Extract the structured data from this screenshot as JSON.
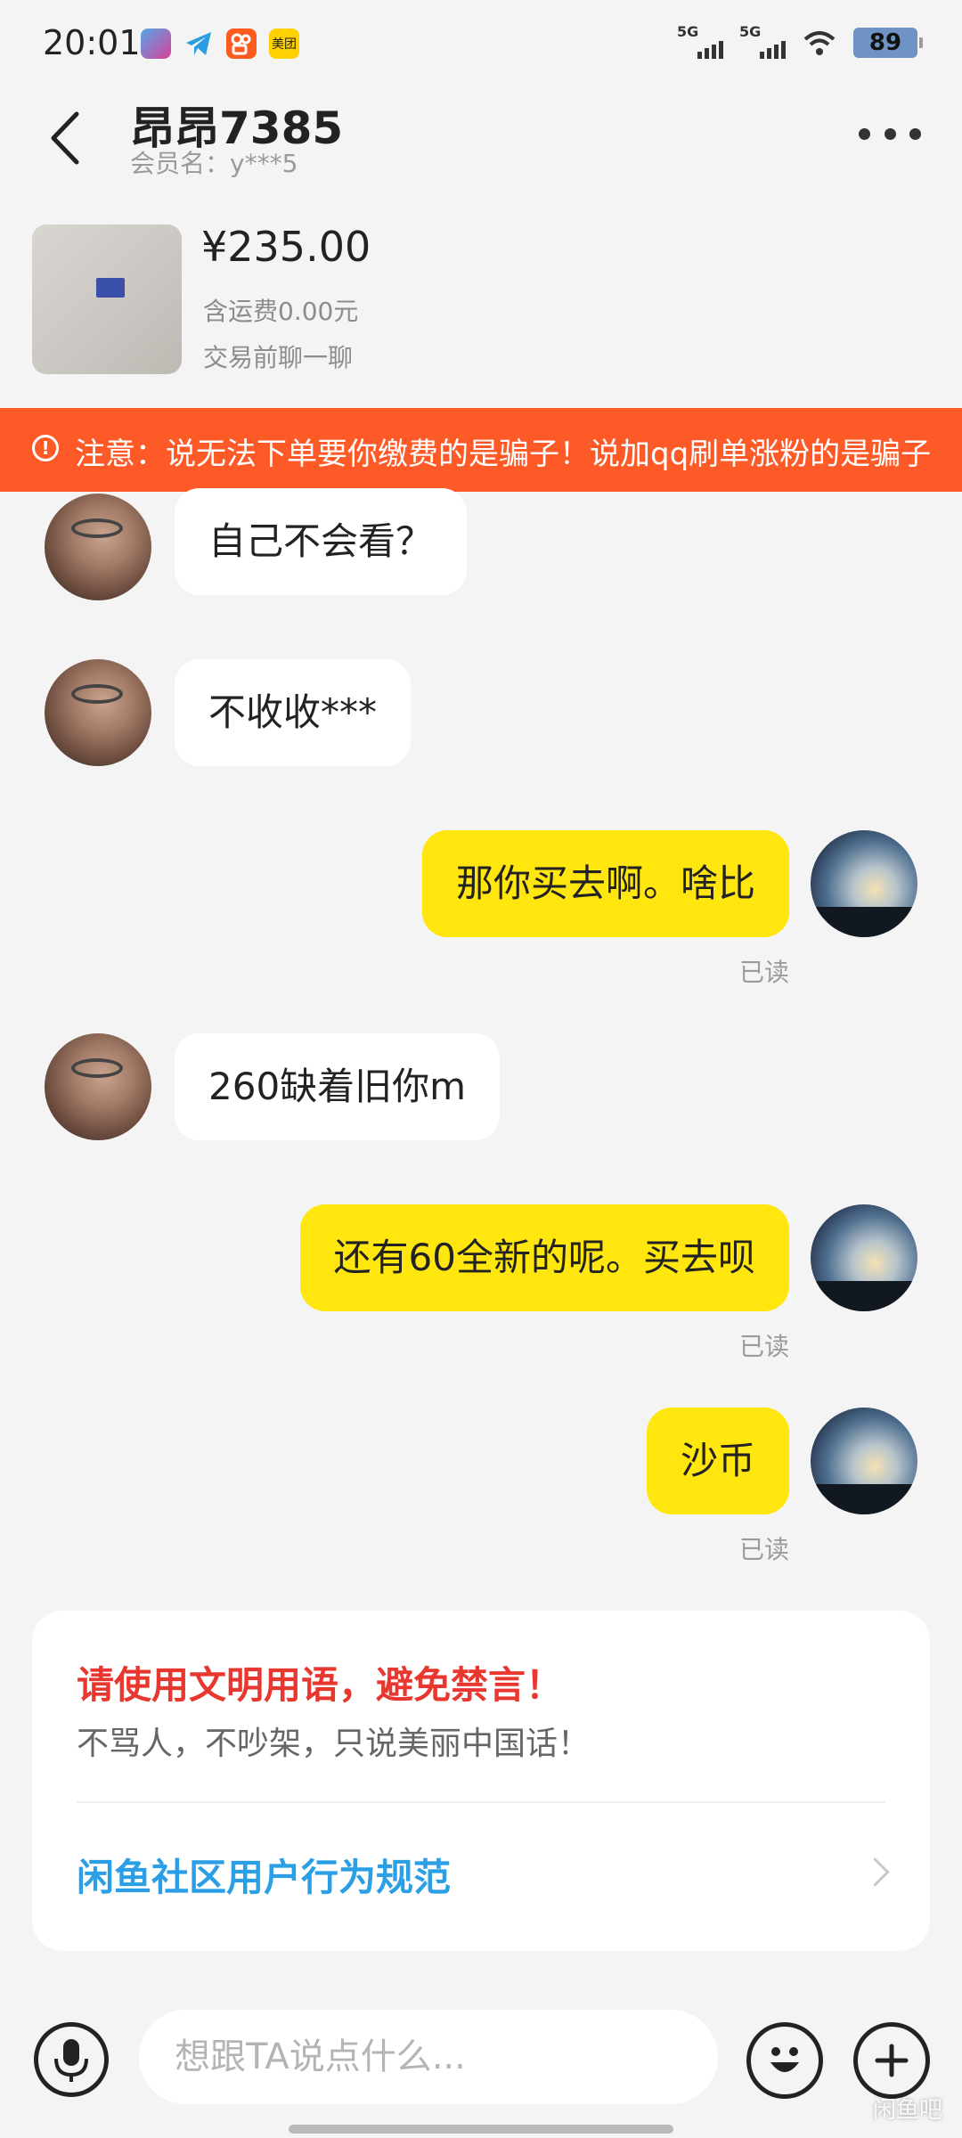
{
  "status_bar": {
    "time": "20:01",
    "app_icons": [
      "photo-app-icon",
      "telegram-app-icon",
      "kuaishou-app-icon",
      "meituan-app-icon"
    ],
    "meituan_label": "美团",
    "signal_1": "5G",
    "signal_2": "5G",
    "battery": "89"
  },
  "header": {
    "seller_name": "昂昂7385",
    "member_name": "会员名：y***5"
  },
  "product": {
    "price": "¥235.00",
    "shipping": "含运费0.00元",
    "chat_before": "交易前聊一聊"
  },
  "warning": {
    "text": "注意：说无法下单要你缴费的是骗子！说加qq刷单涨粉的是骗子"
  },
  "messages": [
    {
      "side": "left",
      "text": "自己不会看？"
    },
    {
      "side": "left",
      "text": "不收收***"
    },
    {
      "side": "right",
      "text": "那你买去啊。啥比",
      "read": "已读"
    },
    {
      "side": "left",
      "text": "260缺着旧你m"
    },
    {
      "side": "right",
      "text": "还有60全新的呢。买去呗",
      "read": "已读"
    },
    {
      "side": "right",
      "text": "沙币",
      "read": "已读"
    }
  ],
  "notice": {
    "title": "请使用文明用语，避免禁言！",
    "subtitle": "不骂人，不吵架，只说美丽中国话！",
    "link": "闲鱼社区用户行为规范"
  },
  "input": {
    "placeholder": "想跟TA说点什么..."
  },
  "watermark": "闲鱼吧",
  "colors": {
    "warning_bg": "#fe5a27",
    "my_bubble": "#ffe60f",
    "notice_title": "#e8372f",
    "notice_link": "#2b9fe6"
  }
}
